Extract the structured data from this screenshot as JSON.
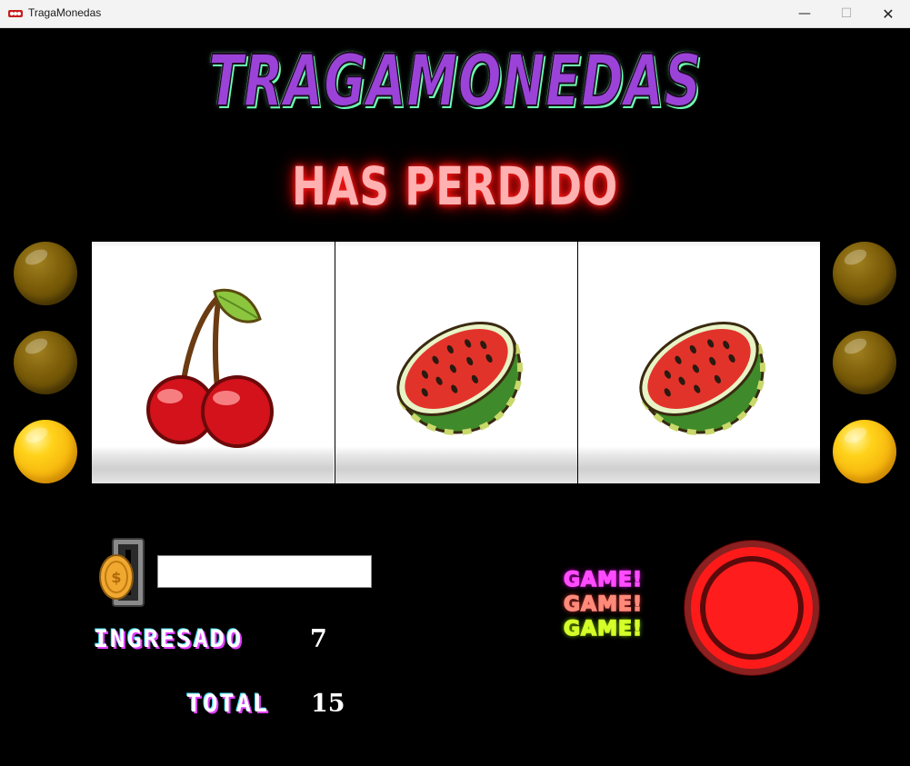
{
  "window": {
    "title": "TragaMonedas",
    "minimize": "—",
    "maximize": "☐",
    "close": "✕"
  },
  "game": {
    "title": "Tragamonedas",
    "status": "HAS PERDIDO",
    "reels": [
      "cherry-icon",
      "watermelon-icon",
      "watermelon-icon"
    ],
    "lamps_left": [
      "off",
      "off",
      "on"
    ],
    "lamps_right": [
      "off",
      "off",
      "on"
    ],
    "bet_input": {
      "value": "",
      "placeholder": ""
    },
    "ingresado": {
      "label": "INGRESADO",
      "value": "7"
    },
    "total": {
      "label": "TOTAL",
      "value": "15"
    },
    "game_sign": [
      "GAME!",
      "GAME!",
      "GAME!"
    ],
    "colors": {
      "title": "#9b43d8",
      "status_glow": "#ff2020",
      "lamp_on": "#ffd21a",
      "lamp_off": "#7a5c08",
      "spin_button": "#ff1a1a"
    }
  }
}
